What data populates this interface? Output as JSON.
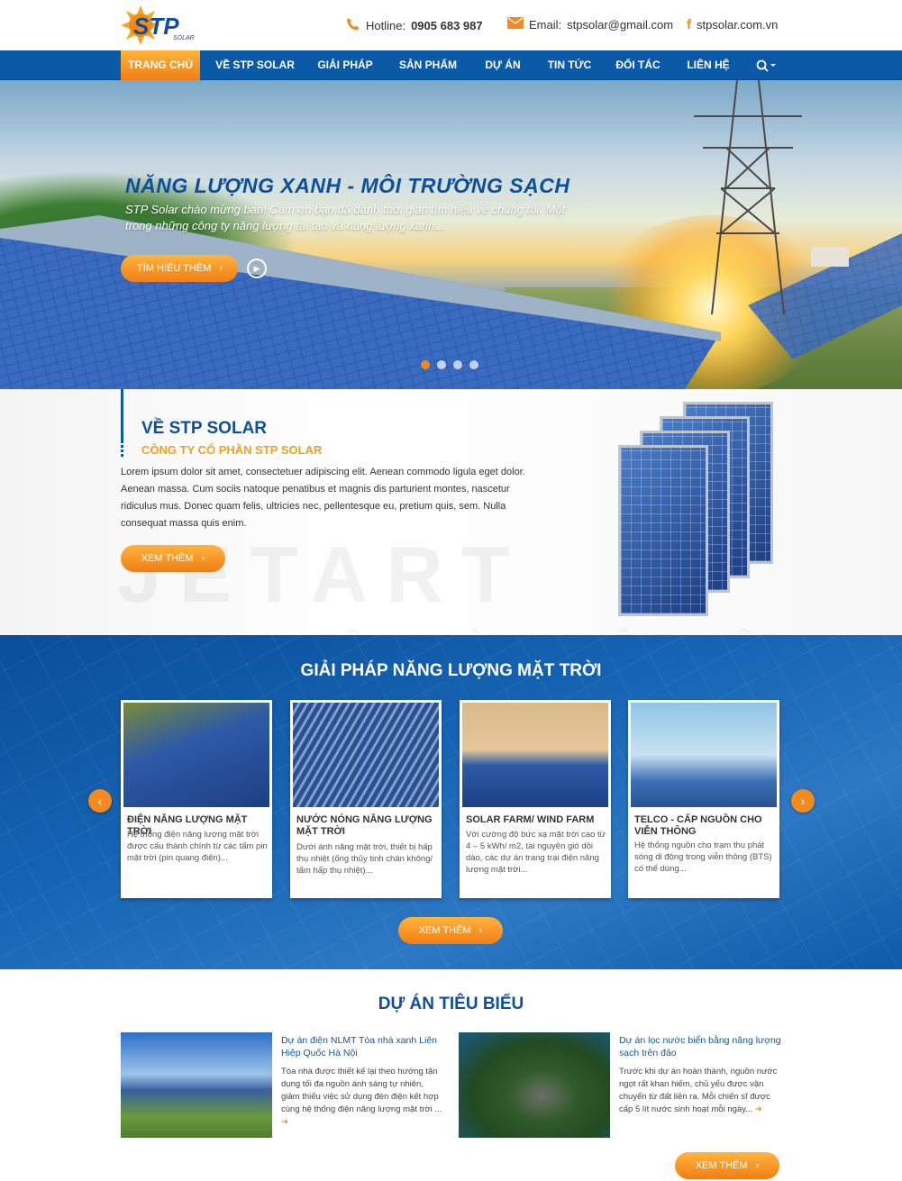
{
  "header": {
    "logo_text": "STP",
    "logo_sub": "SOLAR",
    "hotline_label": "Hotline:",
    "hotline_value": "0905 683 987",
    "email_label": "Email:",
    "email_value": "stpsolar@gmail.com",
    "website": "stpsolar.com.vn"
  },
  "nav": {
    "items": [
      {
        "label": "TRANG CHỦ",
        "active": true
      },
      {
        "label": "VỀ STP SOLAR"
      },
      {
        "label": "GIẢI PHÁP"
      },
      {
        "label": "SẢN PHẨM"
      },
      {
        "label": "DỰ ÁN"
      },
      {
        "label": "TIN TỨC"
      },
      {
        "label": "ĐỐI TÁC"
      },
      {
        "label": "LIÊN HỆ"
      }
    ]
  },
  "hero": {
    "title": "NĂNG LƯỢNG XANH - MÔI TRƯỜNG SẠCH",
    "subtitle": "STP Solar chào mừng bạn! Cảm ơn bạn đã dành thời gian tìm hiểu về chúng tôi. Một trong những công ty năng lượng tái tạo và năng lượng xanh...",
    "button": "TÌM HIỂU THÊM",
    "active_slide": 1,
    "slides": 4
  },
  "about": {
    "title": "VỀ STP SOLAR",
    "subtitle": "CÔNG TY CỔ PHẦN STP SOLAR",
    "text": "Lorem ipsum dolor sit amet, consectetuer adipiscing elit. Aenean commodo ligula eget dolor. Aenean massa. Cum sociis natoque penatibus et magnis dis parturient montes, nascetur ridiculus mus. Donec quam felis, ultricies nec, pellentesque eu, pretium quis, sem. Nulla consequat massa quis enim.",
    "button": "XEM THÊM",
    "watermark": "JETART",
    "watermark_sub": "TẦM NHÌN NGHỆ THUẬT"
  },
  "solutions": {
    "title": "GIẢI PHÁP NĂNG LƯỢNG MẶT TRỜI",
    "cards": [
      {
        "title": "ĐIỆN NĂNG LƯỢNG MẶT TRỜI",
        "desc": "Hệ thống điện năng lượng mặt trời được cấu thành chính từ các tấm pin mặt trời (pin quang điện)..."
      },
      {
        "title": "NƯỚC NÓNG NĂNG LƯỢNG MẶT TRỜI",
        "desc": "Dưới ánh năng mặt trời, thiết bị hấp thụ nhiệt (ống thủy tinh chân không/ tấm hấp thụ nhiệt)..."
      },
      {
        "title": "SOLAR FARM/ WIND FARM",
        "desc": "Với cường độ bức xạ mặt trời cao từ 4 – 5 kWh/ m2, tài nguyên gió dồi dào, các dự án trang trại điện năng lượng mặt trời..."
      },
      {
        "title": "TELCO - CẤP NGUỒN CHO VIỄN THÔNG",
        "desc": "Hệ thống nguồn cho trạm thu phát sóng di động trong viễn thông (BTS) có thể dùng..."
      }
    ],
    "button": "XEM THÊM"
  },
  "projects": {
    "title": "DỰ ÁN TIÊU BIỂU",
    "items": [
      {
        "title": "Dự án điện NLMT Tòa nhà xanh Liên Hiệp Quốc Hà Nội",
        "desc": "Tòa nhà được thiết kế lại theo hướng tận dụng tối đa nguồn ánh sáng tự nhiên, giảm thiểu việc sử dụng đèn điện kết hợp cùng hệ thống điện năng lượng mặt trời ..."
      },
      {
        "title": "Dự án lọc nước biển bằng năng lượng sạch trên đảo",
        "desc": "Trước khi dự án hoàn thành, nguồn nước ngọt rất khan hiếm, chủ yếu được vận chuyển từ đất liền ra. Mỗi chiến sĩ được cấp 5 lít nước sinh hoạt mỗi ngày..."
      }
    ],
    "button": "XEM THÊM"
  },
  "colors": {
    "primary_blue": "#0b5aa8",
    "accent_orange": "#f28a1d",
    "title_blue": "#0d4f9c",
    "subtitle_gold": "#f0a022"
  }
}
